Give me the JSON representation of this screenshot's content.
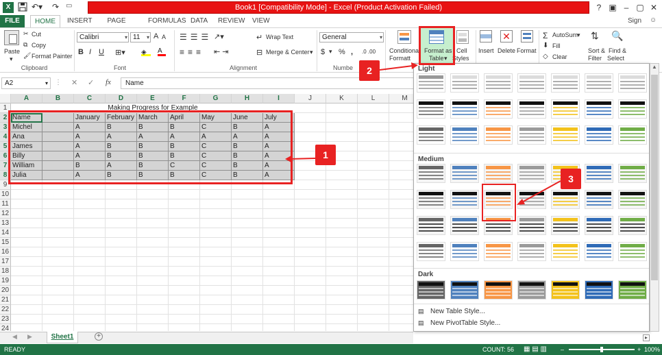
{
  "title_bar": {
    "title": "Book1  [Compatibility Mode]  -  Excel (Product Activation Failed)",
    "help": "?"
  },
  "tabs": [
    "FILE",
    "HOME",
    "INSERT",
    "PAGE LAYOUT",
    "FORMULAS",
    "DATA",
    "REVIEW",
    "VIEW"
  ],
  "sign_in": "Sign in",
  "ribbon": {
    "clipboard": {
      "label": "Clipboard",
      "paste": "Paste",
      "cut": "Cut",
      "copy": "Copy",
      "format_painter": "Format Painter"
    },
    "font": {
      "label": "Font",
      "name": "Calibri",
      "size": "11",
      "bold": "B",
      "italic": "I",
      "underline": "U",
      "grow": "A",
      "shrink": "A"
    },
    "alignment": {
      "label": "Alignment",
      "wrap_text": "Wrap Text",
      "merge_center": "Merge & Center"
    },
    "number": {
      "label": "Numbe",
      "format": "General",
      "currency": "$",
      "percent": "%",
      "comma": ","
    },
    "styles": {
      "conditional_line1": "Conditional",
      "conditional_line2": "Formatt",
      "format_table_line1": "Format as",
      "format_table_line2": "Table",
      "cell_styles_line1": "Cell",
      "cell_styles_line2": "Styles"
    },
    "cells": {
      "insert": "Insert",
      "delete": "Delete",
      "format": "Format"
    },
    "editing": {
      "autosum": "AutoSum",
      "fill": "Fill",
      "clear": "Clear",
      "sort_line1": "Sort &",
      "sort_line2": "Filter",
      "find_line1": "Find &",
      "find_line2": "Select"
    }
  },
  "formula_bar": {
    "name_box": "A2",
    "fx": "fx",
    "cancel": "✕",
    "enter": "✓",
    "content": "Name"
  },
  "columns": [
    "A",
    "B",
    "C",
    "D",
    "E",
    "F",
    "G",
    "H",
    "I",
    "J",
    "K",
    "L",
    "M"
  ],
  "rows": [
    "1",
    "2",
    "3",
    "4",
    "5",
    "6",
    "7",
    "8",
    "9",
    "10",
    "11",
    "12",
    "13",
    "14",
    "15",
    "16",
    "17",
    "18",
    "19",
    "20",
    "21",
    "22",
    "23",
    "24"
  ],
  "sheet": {
    "title": "Making Progress for Example",
    "header": [
      "Name",
      "",
      "January",
      "February",
      "March",
      "April",
      "May",
      "June",
      "July"
    ],
    "data": [
      [
        "Michel",
        "",
        "A",
        "B",
        "B",
        "B",
        "C",
        "B",
        "A"
      ],
      [
        "Ana",
        "",
        "A",
        "A",
        "A",
        "A",
        "A",
        "A",
        "A"
      ],
      [
        "James",
        "",
        "A",
        "B",
        "B",
        "B",
        "C",
        "B",
        "A"
      ],
      [
        "Billy",
        "",
        "A",
        "B",
        "B",
        "B",
        "C",
        "B",
        "A"
      ],
      [
        "William",
        "",
        "B",
        "A",
        "B",
        "C",
        "C",
        "B",
        "A"
      ],
      [
        "Julia",
        "",
        "A",
        "B",
        "B",
        "B",
        "C",
        "B",
        "A"
      ]
    ]
  },
  "gallery": {
    "light_label": "Light",
    "medium_label": "Medium",
    "dark_label": "Dark",
    "new_table_style": "New Table Style...",
    "new_pivot_style": "New PivotTable Style...",
    "palette": [
      "#666666",
      "#4f81bd",
      "#f79646",
      "#9b9b9b",
      "#f3c21b",
      "#2f6bb7",
      "#70ad47"
    ]
  },
  "sheet_tab": "Sheet1",
  "status": {
    "ready": "READY",
    "count": "COUNT: 56",
    "zoom": "100%"
  },
  "annotations": {
    "one": "1",
    "two": "2",
    "three": "3"
  },
  "accent": "#217346"
}
